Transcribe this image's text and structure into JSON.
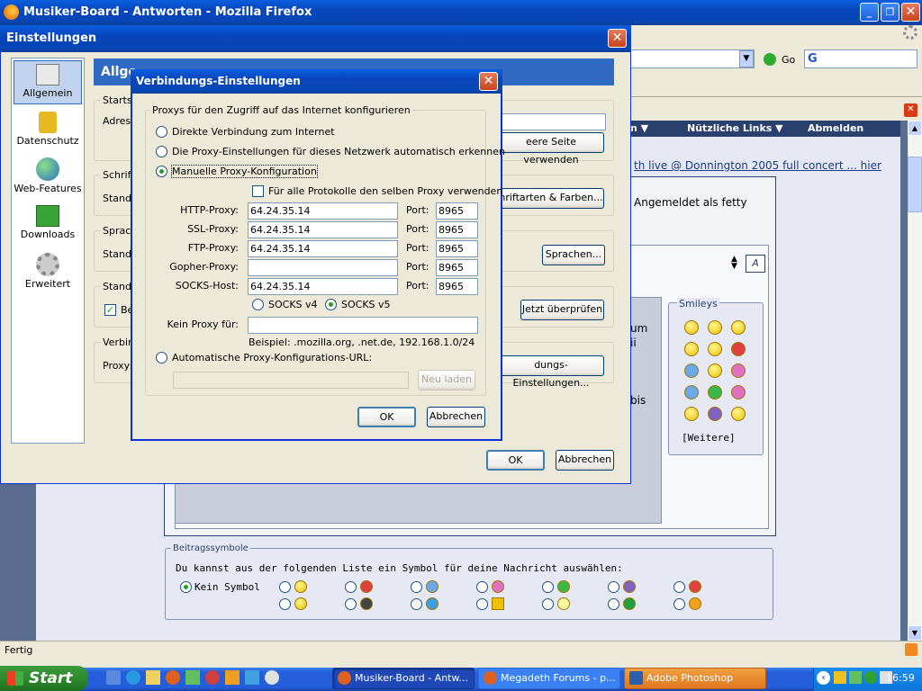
{
  "browser": {
    "title": "Musiker-Board - Antworten - Mozilla Firefox",
    "go_label": "Go",
    "status": "Fertig"
  },
  "forum": {
    "nav_links": [
      "n ▼",
      "Nützliche Links ▼",
      "Abmelden"
    ],
    "link_text": "th live @ Donnington 2005 full concert ... hier",
    "logged_in": "Angemeldet als fetty",
    "fragments": [
      "um",
      "ii",
      "bis"
    ],
    "smileys_title": "Smileys",
    "smileys_more": "[Weitere]",
    "post_symbols": {
      "legend": "Beitragssymbole",
      "intro": "Du kannst aus der folgenden Liste ein Symbol für deine Nachricht auswählen:",
      "none_label": "Kein Symbol"
    }
  },
  "settings": {
    "title": "Einstellungen",
    "sidebar": [
      "Allgemein",
      "Datenschutz",
      "Web-Features",
      "Downloads",
      "Erweitert"
    ],
    "header": "Allge",
    "section_fragments": [
      "Starts",
      "Adress",
      "Schrift",
      "Standa",
      "Sprach",
      "Standa",
      "Standa",
      "Be",
      "Verbin",
      "Proxys"
    ],
    "buttons": {
      "empty_page": "eere Seite verwenden",
      "fonts": "hriftarten & Farben...",
      "languages": "Sprachen...",
      "check_now": "Jetzt überprüfen",
      "conn_settings": "dungs-Einstellungen...",
      "ok": "OK",
      "cancel": "Abbrechen"
    }
  },
  "conn": {
    "title": "Verbindungs-Einstellungen",
    "group_legend": "Proxys für den Zugriff auf das Internet konfigurieren",
    "opt_direct": "Direkte Verbindung zum Internet",
    "opt_auto": "Die Proxy-Einstellungen für dieses Netzwerk automatisch erkennen",
    "opt_manual": "Manuelle Proxy-Konfiguration",
    "same_proxy": "Für alle Protokolle den selben Proxy verwenden",
    "rows": [
      {
        "label": "HTTP-Proxy:",
        "value": "64.24.35.14",
        "port": "8965"
      },
      {
        "label": "SSL-Proxy:",
        "value": "64.24.35.14",
        "port": "8965"
      },
      {
        "label": "FTP-Proxy:",
        "value": "64.24.35.14",
        "port": "8965"
      },
      {
        "label": "Gopher-Proxy:",
        "value": "",
        "port": "8965"
      },
      {
        "label": "SOCKS-Host:",
        "value": "64.24.35.14",
        "port": "8965"
      }
    ],
    "port_label": "Port:",
    "socks4": "SOCKS v4",
    "socks5": "SOCKS v5",
    "no_proxy_label": "Kein Proxy für:",
    "example": "Beispiel: .mozilla.org, .net.de, 192.168.1.0/24",
    "opt_pac": "Automatische Proxy-Konfigurations-URL:",
    "reload": "Neu laden",
    "ok": "OK",
    "cancel": "Abbrechen"
  },
  "taskbar": {
    "start": "Start",
    "tasks": [
      "Musiker-Board - Antw...",
      "Megadeth Forums - p...",
      "Adobe Photoshop"
    ],
    "clock": "16:59"
  },
  "colors": {
    "xp_blue": "#0a5fde",
    "dialog_bg": "#ece9d8",
    "forum_bg": "#e6e9f3",
    "taskbar": "#245edb",
    "start": "#3c9a3c"
  }
}
